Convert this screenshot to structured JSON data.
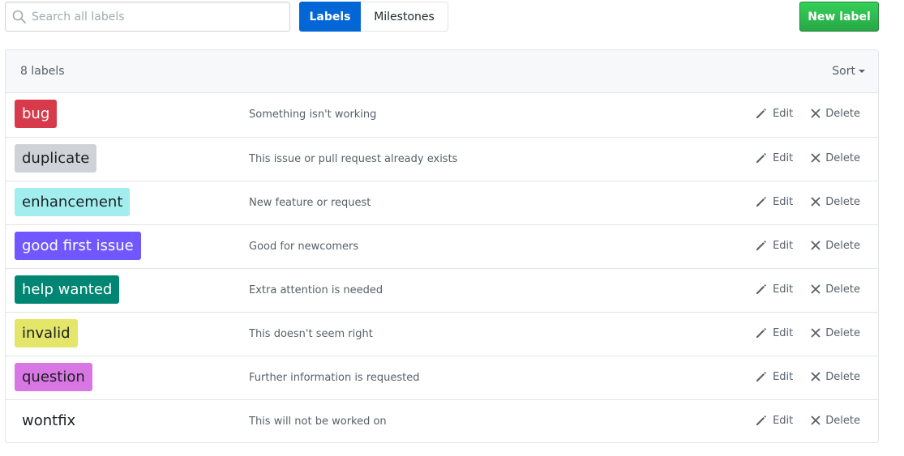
{
  "search": {
    "placeholder": "Search all labels",
    "value": ""
  },
  "nav": {
    "labels_tab": "Labels",
    "milestones_tab": "Milestones"
  },
  "new_label_button": "New label",
  "list": {
    "count_text": "8 labels",
    "sort_label": "Sort",
    "edit_label": "Edit",
    "delete_label": "Delete",
    "items": [
      {
        "name": "bug",
        "description": "Something isn't working",
        "color": "#d73a4a",
        "text_color": "#ffffff"
      },
      {
        "name": "duplicate",
        "description": "This issue or pull request already exists",
        "color": "#cfd3d7",
        "text_color": "#1b1f23"
      },
      {
        "name": "enhancement",
        "description": "New feature or request",
        "color": "#a2eeef",
        "text_color": "#1b1f23"
      },
      {
        "name": "good first issue",
        "description": "Good for newcomers",
        "color": "#7057ff",
        "text_color": "#ffffff"
      },
      {
        "name": "help wanted",
        "description": "Extra attention is needed",
        "color": "#008672",
        "text_color": "#ffffff"
      },
      {
        "name": "invalid",
        "description": "This doesn't seem right",
        "color": "#e4e669",
        "text_color": "#1b1f23"
      },
      {
        "name": "question",
        "description": "Further information is requested",
        "color": "#d876e3",
        "text_color": "#1b1f23"
      },
      {
        "name": "wontfix",
        "description": "This will not be worked on",
        "color": "#ffffff",
        "text_color": "#1b1f23"
      }
    ]
  },
  "colors": {
    "primary_blue": "#0366d6",
    "new_label_green": "#2cbe4e",
    "border": "#e1e4e8"
  },
  "icons": {
    "search": "search-icon",
    "edit": "pencil-icon",
    "delete": "x-icon"
  }
}
